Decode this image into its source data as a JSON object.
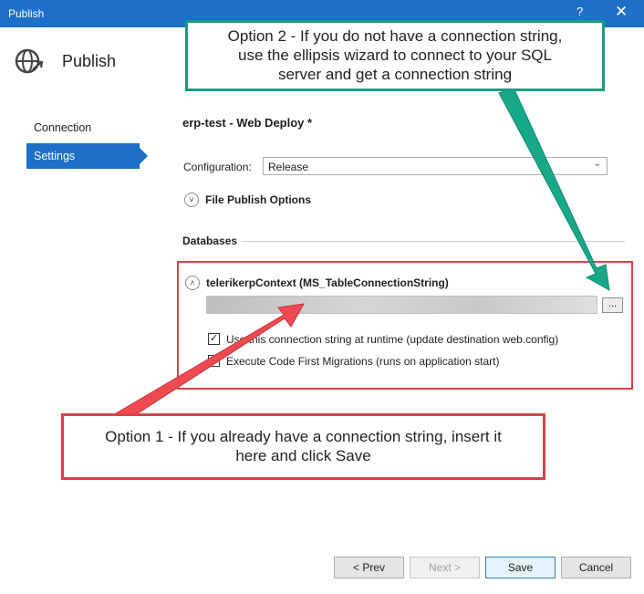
{
  "window": {
    "title": "Publish",
    "help": "?",
    "close": "✕"
  },
  "header": {
    "title": "Publish"
  },
  "sidebar": {
    "items": [
      {
        "label": "Connection",
        "active": false
      },
      {
        "label": "Settings",
        "active": true
      }
    ]
  },
  "main": {
    "profile_name": "erp-test",
    "profile_suffix": " - Web Deploy *",
    "configuration_label": "Configuration:",
    "configuration_value": "Release",
    "file_publish_options": "File Publish Options",
    "databases_header": "Databases",
    "db_context": "telerikerpContext (MS_TableConnectionString)",
    "ellipsis_button": "...",
    "checkbox1_label": "Use this connection string at runtime (update destination web.config)",
    "checkbox1_checked": true,
    "checkbox2_label": "Execute Code First Migrations (runs on application start)",
    "checkbox2_checked": false
  },
  "buttons": {
    "prev": "< Prev",
    "next": "Next >",
    "save": "Save",
    "cancel": "Cancel"
  },
  "annotations": {
    "option2_line1": "Option 2 - If you do not have a connection string,",
    "option2_line2": "use the ellipsis wizard to connect to your SQL",
    "option2_line3": "server and get a connection string",
    "option1_line1": "Option 1 - If you already have a connection string, insert it",
    "option1_line2": "here and click Save"
  },
  "colors": {
    "accent": "#1e6fc8",
    "callout_green": "#1a9b81",
    "callout_red": "#d9414a"
  },
  "icons": {
    "header": "globe-publish-icon",
    "expander": "chevron-down-icon"
  }
}
